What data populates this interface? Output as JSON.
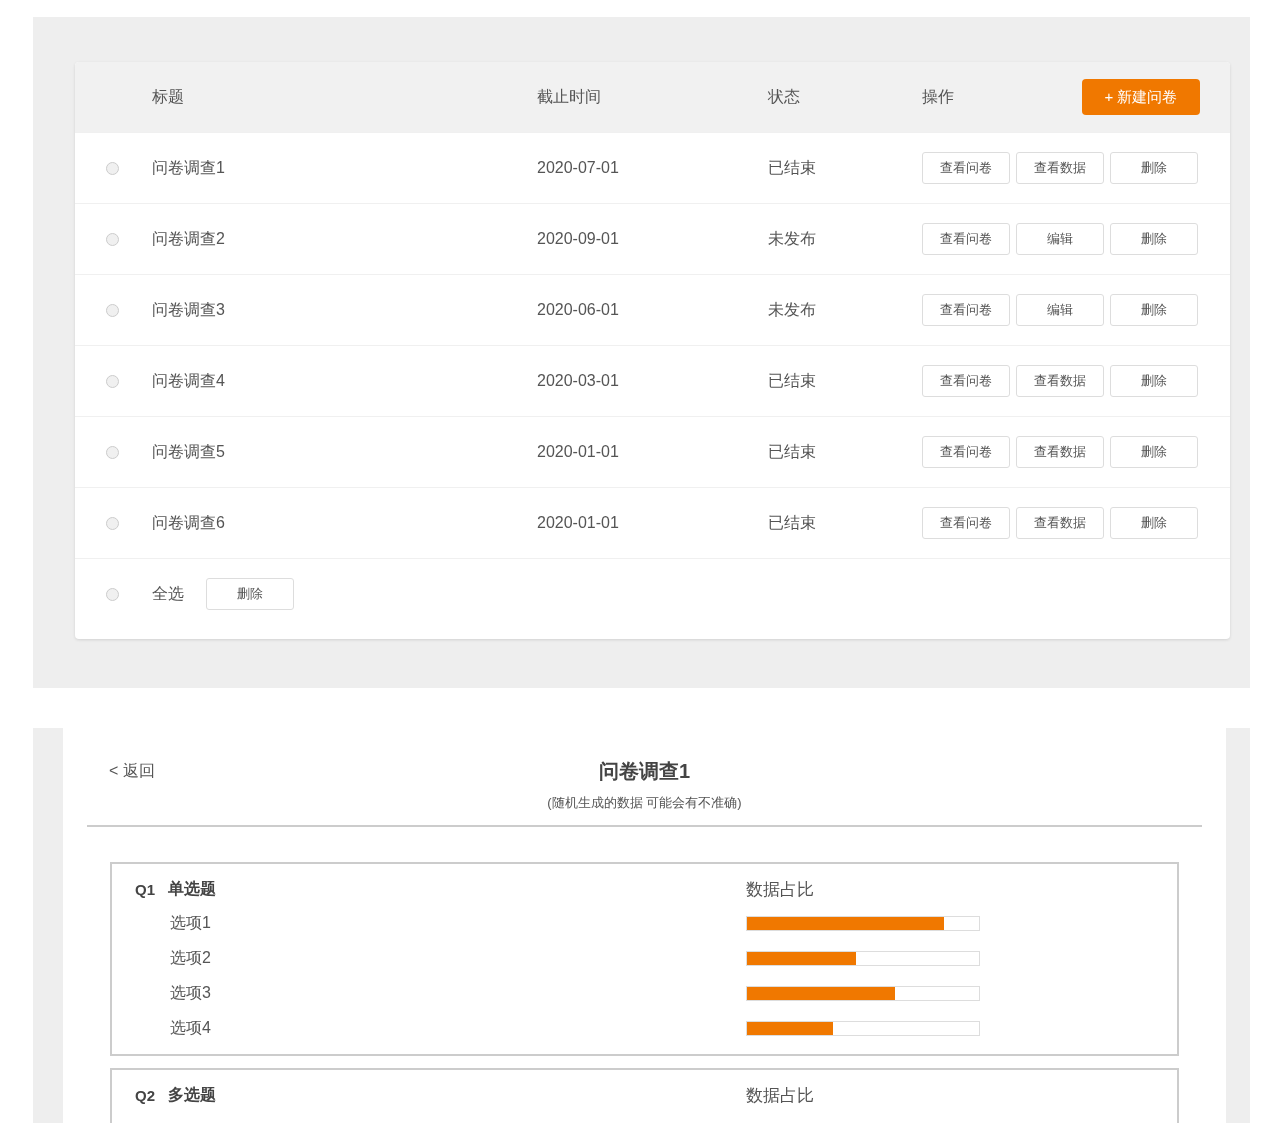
{
  "survey_table": {
    "columns": [
      "标题",
      "截止时间",
      "状态",
      "操作"
    ],
    "new_button": "+ 新建问卷",
    "rows": [
      {
        "selected": false,
        "title": "问卷调查1",
        "deadline": "2020-07-01",
        "status": "已结束",
        "actions": [
          "查看问卷",
          "查看数据",
          "删除"
        ]
      },
      {
        "selected": false,
        "title": "问卷调查2",
        "deadline": "2020-09-01",
        "status": "未发布",
        "actions": [
          "查看问卷",
          "编辑",
          "删除"
        ]
      },
      {
        "selected": false,
        "title": "问卷调查3",
        "deadline": "2020-06-01",
        "status": "未发布",
        "actions": [
          "查看问卷",
          "编辑",
          "删除"
        ]
      },
      {
        "selected": false,
        "title": "问卷调查4",
        "deadline": "2020-03-01",
        "status": "已结束",
        "actions": [
          "查看问卷",
          "查看数据",
          "删除"
        ]
      },
      {
        "selected": false,
        "title": "问卷调查5",
        "deadline": "2020-01-01",
        "status": "已结束",
        "actions": [
          "查看问卷",
          "查看数据",
          "删除"
        ]
      },
      {
        "selected": false,
        "title": "问卷调查6",
        "deadline": "2020-01-01",
        "status": "已结束",
        "actions": [
          "查看问卷",
          "查看数据",
          "删除"
        ]
      }
    ],
    "footer": {
      "select_all": {
        "label": "全选",
        "selected": false
      },
      "delete_button": "删除"
    }
  },
  "survey_data": {
    "back_link": "< 返回",
    "title": "问卷调查1",
    "subtitle": "(随机生成的数据 可能会有不准确)",
    "questions": [
      {
        "number": "Q1",
        "type": "单选题",
        "ratio_label": "数据占比",
        "options": [
          {
            "label": "选项1",
            "level": 0.85
          },
          {
            "label": "选项2",
            "level": 0.47
          },
          {
            "label": "选项3",
            "level": 0.64
          },
          {
            "label": "选项4",
            "level": 0.37
          }
        ]
      },
      {
        "number": "Q2",
        "type": "多选题",
        "ratio_label": "数据占比"
      }
    ]
  }
}
